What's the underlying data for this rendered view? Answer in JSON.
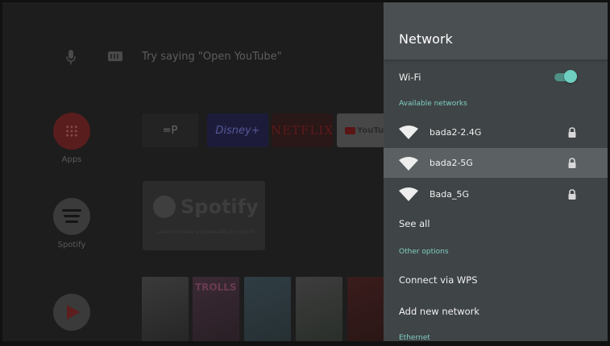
{
  "home": {
    "assistant_hint": "Try saying \"Open YouTube\"",
    "sidebar": [
      {
        "label": "Apps",
        "icon": "apps-grid-icon"
      },
      {
        "label": "Spotify",
        "icon": "spotify-icon"
      },
      {
        "label": "",
        "icon": "play-store-icon"
      }
    ],
    "tiles": [
      {
        "label": "=P"
      },
      {
        "label": "Disney+"
      },
      {
        "label": "NETFLIX"
      },
      {
        "label": "YouTube"
      }
    ],
    "banner": {
      "title": "Spotify",
      "subtitle": "Listen to music and podcasts on your TV"
    },
    "posters": [
      {
        "caption": ""
      },
      {
        "caption": "TROLLS"
      },
      {
        "caption": ""
      },
      {
        "caption": ""
      },
      {
        "caption": ""
      }
    ]
  },
  "panel": {
    "title": "Network",
    "wifi": {
      "label": "Wi-Fi",
      "enabled": true
    },
    "available_label": "Available networks",
    "networks": [
      {
        "ssid": "bada2-2.4G",
        "secured": true,
        "selected": false
      },
      {
        "ssid": "bada2-5G",
        "secured": true,
        "selected": true
      },
      {
        "ssid": "Bada_5G",
        "secured": true,
        "selected": false
      }
    ],
    "see_all": "See all",
    "other_label": "Other options",
    "connect_wps": "Connect via WPS",
    "add_network": "Add new network",
    "ethernet_label": "Ethernet"
  },
  "colors": {
    "panel_bg": "#3f4446",
    "header_bg": "#4a4f51",
    "selected_row": "#5b6163",
    "accent": "#7fcfc3",
    "toggle_thumb": "#6fd0c2"
  }
}
